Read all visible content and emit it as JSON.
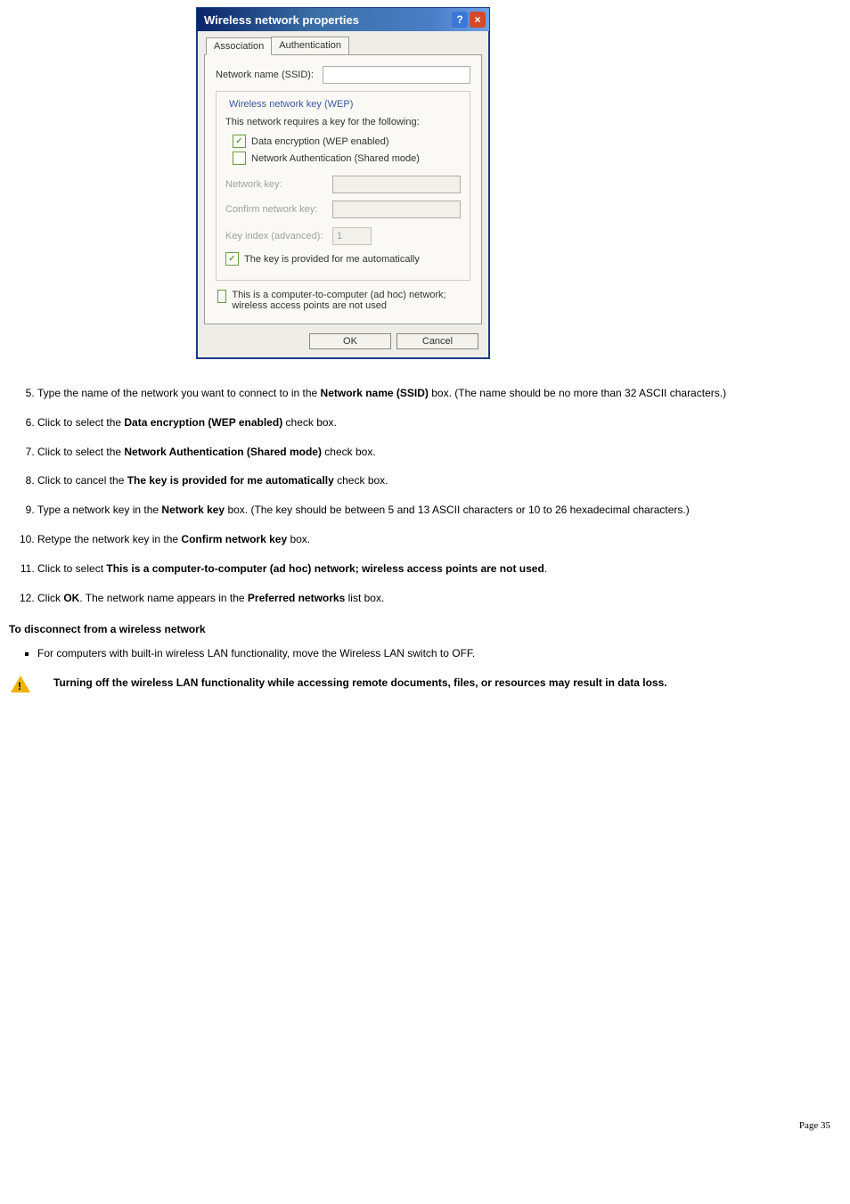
{
  "dialog": {
    "title": "Wireless network properties",
    "help_glyph": "?",
    "close_glyph": "×",
    "tabs": {
      "association": "Association",
      "authentication": "Authentication"
    },
    "ssid_label": "Network name (SSID):",
    "wep_legend": "Wireless network key (WEP)",
    "requires_key": "This network requires a key for the following:",
    "cb_wep": "Data encryption (WEP enabled)",
    "cb_auth": "Network Authentication (Shared mode)",
    "netkey_label": "Network key:",
    "confirm_label": "Confirm network key:",
    "keyindex_label": "Key index (advanced):",
    "keyindex_value": "1",
    "cb_auto": "The key is provided for me automatically",
    "cb_adhoc": "This is a computer-to-computer (ad hoc) network; wireless access points are not used",
    "ok": "OK",
    "cancel": "Cancel",
    "check_glyph": "✓"
  },
  "steps": {
    "s5a": "Type the name of the network you want to connect to in the ",
    "s5b": "Network name (SSID)",
    "s5c": " box. (The name should be no more than 32 ASCII characters.)",
    "s6a": "Click to select the ",
    "s6b": "Data encryption (WEP enabled)",
    "s6c": " check box.",
    "s7a": "Click to select the ",
    "s7b": "Network Authentication (Shared mode)",
    "s7c": " check box.",
    "s8a": "Click to cancel the ",
    "s8b": "The key is provided for me automatically",
    "s8c": " check box.",
    "s9a": "Type a network key in the ",
    "s9b": "Network key",
    "s9c": " box. (The key should be between 5 and 13 ASCII characters or 10 to 26 hexadecimal characters.)",
    "s10a": "Retype the network key in the ",
    "s10b": "Confirm network key",
    "s10c": " box.",
    "s11a": "Click to select ",
    "s11b": "This is a computer-to-computer (ad hoc) network; wireless access points are not used",
    "s11c": ".",
    "s12a": "Click ",
    "s12b": "OK",
    "s12c": ". The network name appears in the ",
    "s12d": "Preferred networks",
    "s12e": " list box."
  },
  "disconnect_head": "To disconnect from a wireless network",
  "disconnect_bullet": "For computers with built-in wireless LAN functionality, move the Wireless LAN switch to OFF.",
  "warning": "Turning off the wireless LAN functionality while accessing remote documents, files, or resources may result in data loss.",
  "page_label": "Page 35"
}
